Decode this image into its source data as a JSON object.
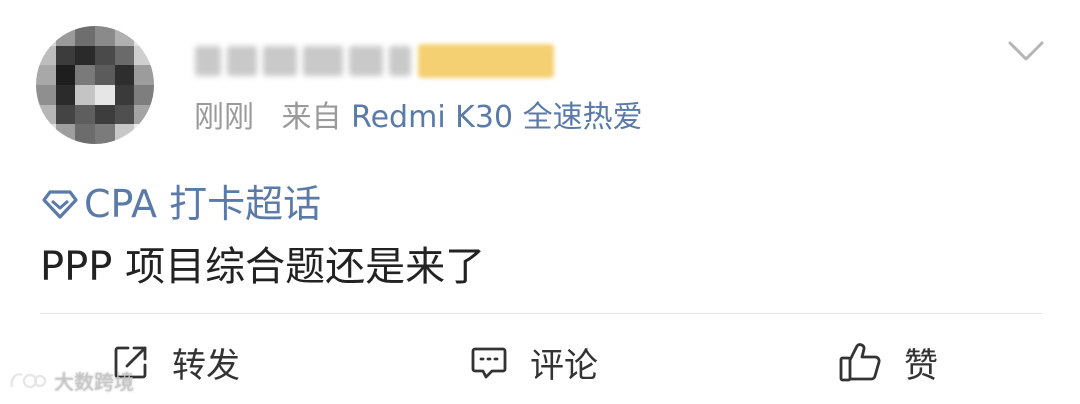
{
  "post": {
    "time": "刚刚",
    "source_prefix": "来自",
    "device": "Redmi K30 全速热爱",
    "topic_label": "CPA 打卡超话",
    "content": "PPP 项目综合题还是来了"
  },
  "actions": {
    "repost_label": "转发",
    "comment_label": "评论",
    "like_label": "赞"
  },
  "watermark": "大数跨境",
  "icons": {
    "menu": "chevron-down-icon",
    "topic": "diamond-icon",
    "repost": "share-icon",
    "comment": "comment-icon",
    "like": "thumbs-up-icon"
  },
  "colors": {
    "link": "#5a7aa8",
    "muted": "#9a9a9a",
    "text": "#222222"
  }
}
